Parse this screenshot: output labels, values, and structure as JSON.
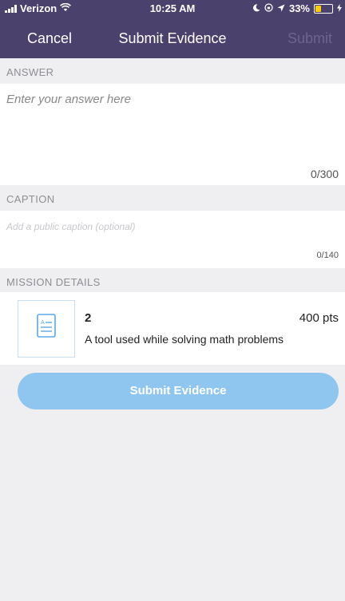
{
  "status_bar": {
    "carrier": "Verizon",
    "time": "10:25 AM",
    "battery_text": "33%",
    "battery_level": 0.33,
    "icons": [
      "signal-icon",
      "wifi-icon",
      "moon-icon",
      "orientation-lock-icon",
      "location-icon",
      "battery-icon",
      "charging-icon"
    ]
  },
  "navbar": {
    "cancel_label": "Cancel",
    "title": "Submit Evidence",
    "submit_label": "Submit",
    "background_color": "#4a416c"
  },
  "answer": {
    "section_label": "ANSWER",
    "placeholder": "Enter your answer here",
    "counter": "0/300"
  },
  "caption": {
    "section_label": "CAPTION",
    "placeholder": "Add a public caption (optional)",
    "counter": "0/140"
  },
  "mission": {
    "section_label": "MISSION DETAILS",
    "title": "2",
    "points": "400 pts",
    "description": "A tool used while solving math problems",
    "icon": "document-icon"
  },
  "submit_button": {
    "label": "Submit Evidence",
    "color": "#8fc6f0"
  }
}
